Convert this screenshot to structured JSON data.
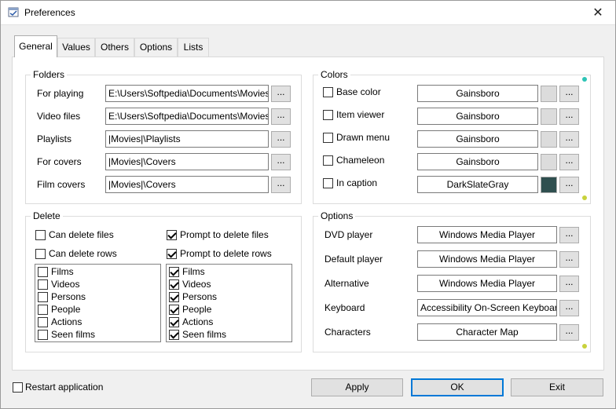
{
  "window": {
    "title": "Preferences",
    "close_glyph": "✕"
  },
  "tabs": [
    {
      "label": "General",
      "active": true
    },
    {
      "label": "Values"
    },
    {
      "label": "Others"
    },
    {
      "label": "Options"
    },
    {
      "label": "Lists"
    }
  ],
  "folders": {
    "title": "Folders",
    "rows": [
      {
        "label": "For playing",
        "value": "E:\\Users\\Softpedia\\Documents\\Movies"
      },
      {
        "label": "Video files",
        "value": "E:\\Users\\Softpedia\\Documents\\Movies"
      },
      {
        "label": "Playlists",
        "value": "|Movies|\\Playlists"
      },
      {
        "label": "For covers",
        "value": "|Movies|\\Covers"
      },
      {
        "label": "Film covers",
        "value": "|Movies|\\Covers"
      }
    ],
    "browse_label": "..."
  },
  "colors": {
    "title": "Colors",
    "rows": [
      {
        "label": "Base color",
        "value": "Gainsboro",
        "swatch": "#dcdcdc",
        "checked": false
      },
      {
        "label": "Item viewer",
        "value": "Gainsboro",
        "swatch": "#dcdcdc",
        "checked": false
      },
      {
        "label": "Drawn menu",
        "value": "Gainsboro",
        "swatch": "#dcdcdc",
        "checked": false
      },
      {
        "label": "Chameleon",
        "value": "Gainsboro",
        "swatch": "#dcdcdc",
        "checked": false
      },
      {
        "label": "In caption",
        "value": "DarkSlateGray",
        "swatch": "#2f4f4f",
        "checked": false
      }
    ],
    "browse_label": "..."
  },
  "delete": {
    "title": "Delete",
    "can_delete_files": {
      "label": "Can delete files",
      "checked": false
    },
    "can_delete_rows": {
      "label": "Can delete rows",
      "checked": false
    },
    "prompt_delete_files": {
      "label": "Prompt to delete files",
      "checked": true
    },
    "prompt_delete_rows": {
      "label": "Prompt to delete rows",
      "checked": true
    },
    "left_list": [
      {
        "label": "Films",
        "checked": false
      },
      {
        "label": "Videos",
        "checked": false
      },
      {
        "label": "Persons",
        "checked": false
      },
      {
        "label": "People",
        "checked": false
      },
      {
        "label": "Actions",
        "checked": false
      },
      {
        "label": "Seen films",
        "checked": false
      }
    ],
    "right_list": [
      {
        "label": "Films",
        "checked": true
      },
      {
        "label": "Videos",
        "checked": true
      },
      {
        "label": "Persons",
        "checked": true
      },
      {
        "label": "People",
        "checked": true
      },
      {
        "label": "Actions",
        "checked": true
      },
      {
        "label": "Seen films",
        "checked": true
      }
    ]
  },
  "options": {
    "title": "Options",
    "rows": [
      {
        "label": "DVD player",
        "value": "Windows Media Player"
      },
      {
        "label": "Default player",
        "value": "Windows Media Player"
      },
      {
        "label": "Alternative",
        "value": "Windows Media Player"
      },
      {
        "label": "Keyboard",
        "value": "Accessibility On-Screen Keyboard"
      },
      {
        "label": "Characters",
        "value": "Character Map"
      }
    ],
    "browse_label": "..."
  },
  "footer": {
    "restart": {
      "label": "Restart application",
      "checked": false
    },
    "apply_label": "Apply",
    "ok_label": "OK",
    "exit_label": "Exit"
  },
  "accent_colors": {
    "focus": "#0078d7",
    "scroll_dot_top": "#2ec4b6",
    "scroll_dot_bottom": "#c8d23c"
  }
}
